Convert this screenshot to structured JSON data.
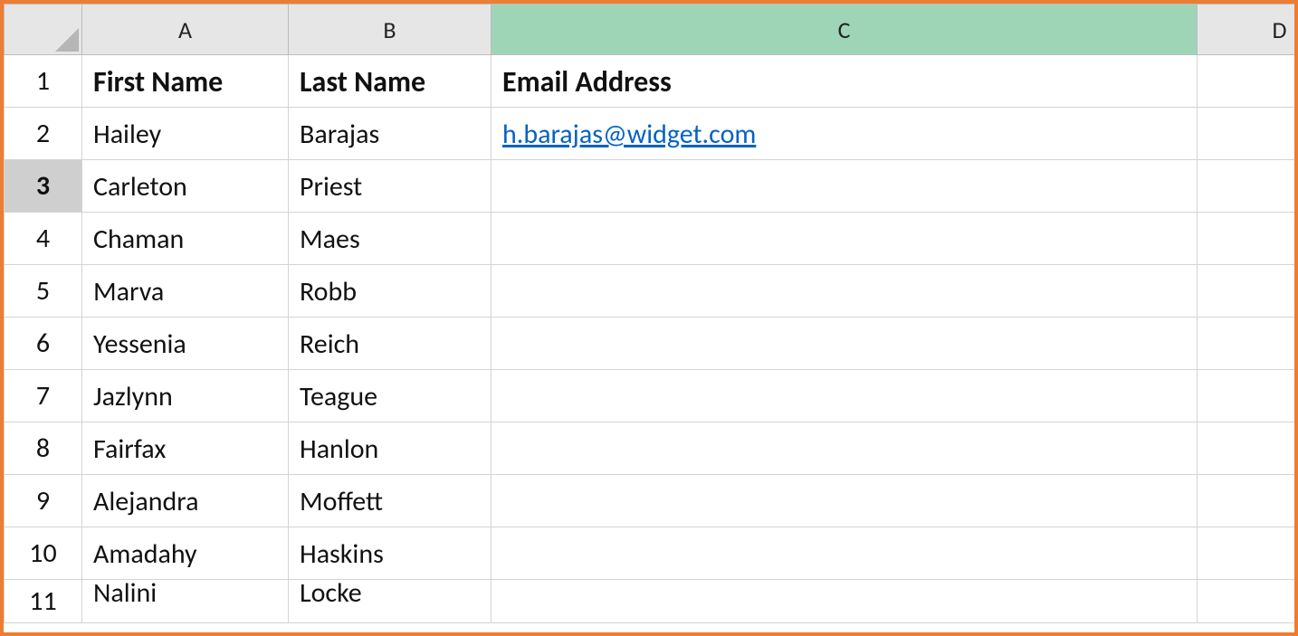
{
  "columns": {
    "A": "A",
    "B": "B",
    "C": "C",
    "D": "D"
  },
  "row_numbers": [
    "1",
    "2",
    "3",
    "4",
    "5",
    "6",
    "7",
    "8",
    "9",
    "10",
    "11"
  ],
  "selected_column": "C",
  "active_row": "3",
  "headers": {
    "A": "First Name",
    "B": "Last Name",
    "C": "Email Address"
  },
  "rows": [
    {
      "first": "Hailey",
      "last": "Barajas",
      "email": "h.barajas@widget.com"
    },
    {
      "first": "Carleton",
      "last": "Priest",
      "email": ""
    },
    {
      "first": "Chaman",
      "last": "Maes",
      "email": ""
    },
    {
      "first": "Marva",
      "last": "Robb",
      "email": ""
    },
    {
      "first": "Yessenia",
      "last": "Reich",
      "email": ""
    },
    {
      "first": "Jazlynn",
      "last": "Teague",
      "email": ""
    },
    {
      "first": "Fairfax",
      "last": "Hanlon",
      "email": ""
    },
    {
      "first": "Alejandra",
      "last": "Moffett",
      "email": ""
    },
    {
      "first": "Amadahy",
      "last": "Haskins",
      "email": ""
    },
    {
      "first": "Nalini",
      "last": "Locke",
      "email": ""
    }
  ],
  "colors": {
    "frame_border": "#ed7d31",
    "header_bg": "#e6e6e6",
    "selected_col_bg": "#9fd5b7",
    "selected_col_text": "#0f6b3e",
    "link": "#0563c1"
  }
}
